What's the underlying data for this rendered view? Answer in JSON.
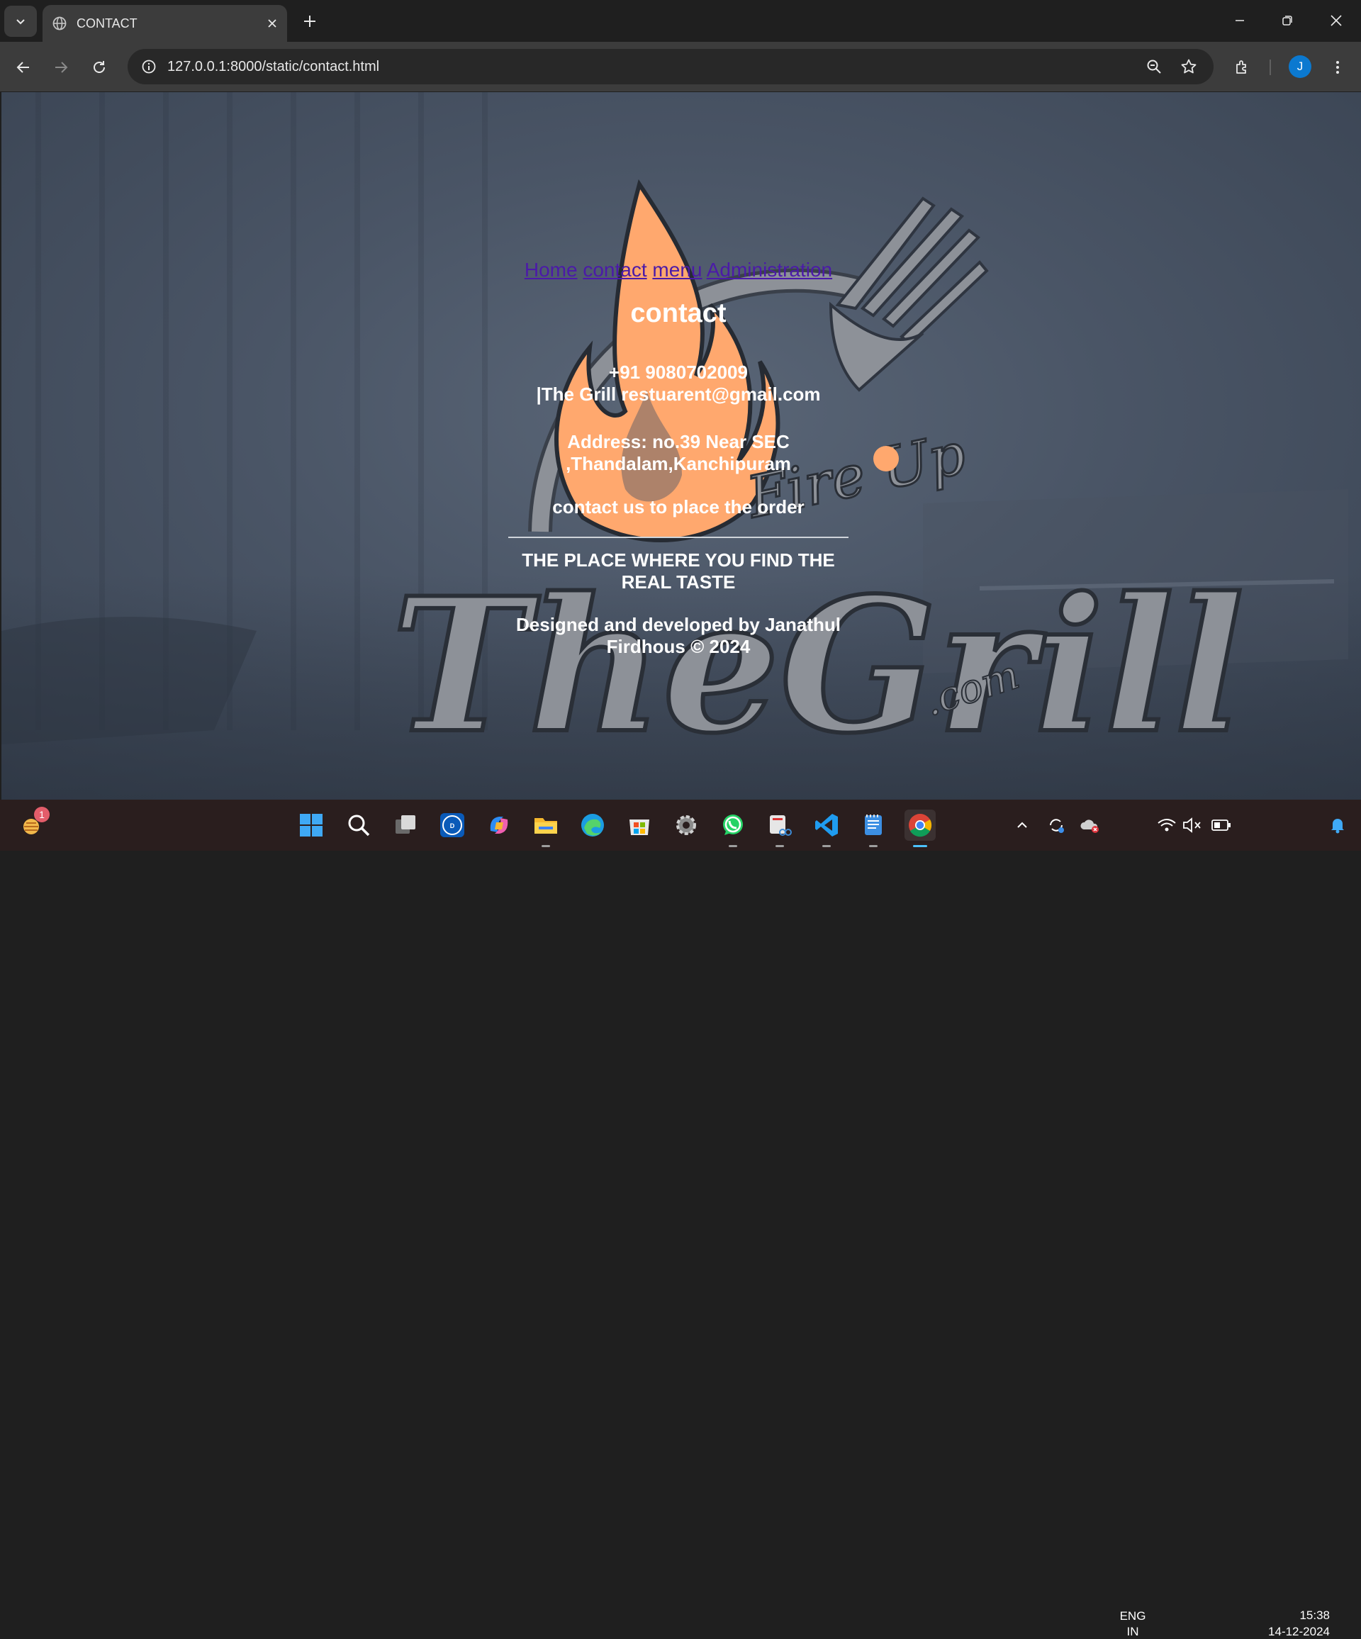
{
  "browser": {
    "tab_title": "CONTACT",
    "url_host": "127.0.0.1",
    "url_path": ":8000/static/contact.html",
    "profile_initial": "J"
  },
  "page": {
    "nav": [
      "Home",
      "contact",
      "menu",
      "Administration"
    ],
    "heading": "contact",
    "phone": "+91 9080702009",
    "email": "|The Grill restuarent@gmail.com",
    "address_line1": "Address: no.39 Near SEC",
    "address_line2": ",Thandalam,Kanchipuram",
    "cta": "contact us to place the order",
    "tagline_line1": "THE PLACE WHERE YOU FIND THE",
    "tagline_line2": "REAL TASTE",
    "credit_line1": "Designed and developed by Janathul",
    "credit_line2": "Firdhous © 2024",
    "logo": {
      "script": "Fire Up",
      "name": "TheGrill",
      "domain": ".com"
    }
  },
  "taskbar": {
    "weather_badge": "1",
    "language": "ENG",
    "region": "IN",
    "time": "15:38",
    "date": "14-12-2024",
    "apps": [
      "start",
      "search",
      "task-view",
      "dell",
      "copilot",
      "file-explorer",
      "edge",
      "store",
      "settings",
      "whatsapp",
      "snipping-tool",
      "vscode",
      "notepad",
      "chrome"
    ]
  },
  "colors": {
    "link": "#4b1aa8",
    "flame": "#ffa86e",
    "logo_gray": "#8d9198",
    "accent": "#4cc2ff"
  }
}
